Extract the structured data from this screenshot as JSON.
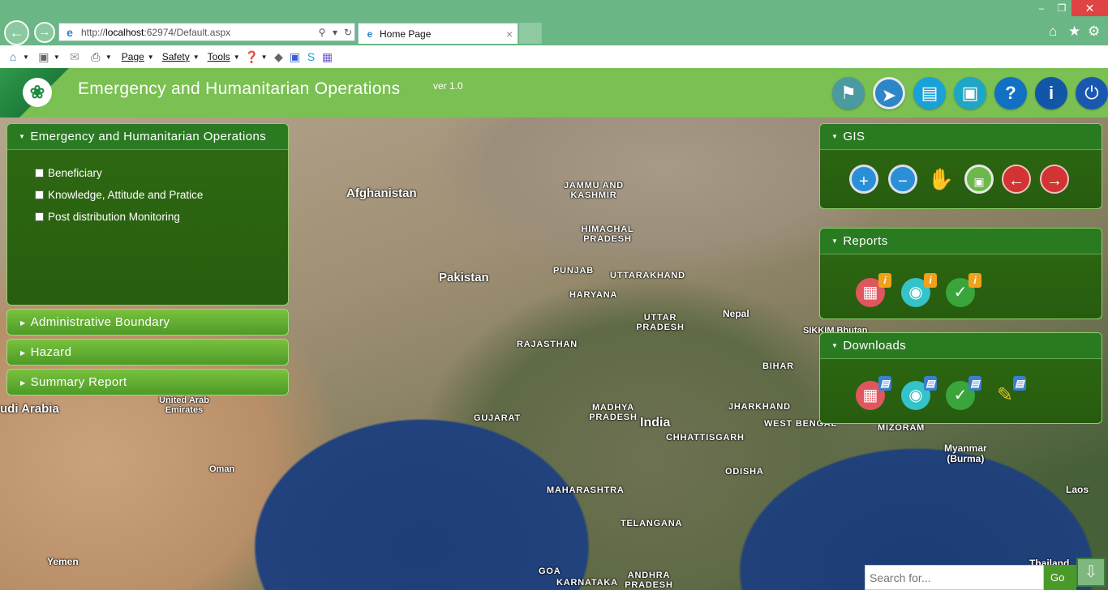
{
  "browser": {
    "address_prefix": "http://",
    "address_host": "localhost",
    "address_rest": ":62974/Default.aspx",
    "tab_title": "Home Page",
    "menu": {
      "page": "Page",
      "safety": "Safety",
      "tools": "Tools"
    }
  },
  "app": {
    "title": "Emergency and Humanitarian Operations",
    "version": "ver 1.0",
    "header_icons": [
      "map-icon",
      "compass-icon",
      "document-icon",
      "monitor-download-icon",
      "help-icon",
      "info-icon",
      "power-icon"
    ]
  },
  "left_panel": {
    "main": {
      "title": "Emergency and Humanitarian Operations",
      "items": [
        "Beneficiary",
        "Knowledge, Attitude and Pratice",
        "Post distribution Monitoring"
      ]
    },
    "accordions": [
      "Administrative Boundary",
      "Hazard",
      "Summary Report"
    ]
  },
  "right_panels": {
    "gis": {
      "title": "GIS",
      "tools": [
        "zoom-in-icon",
        "zoom-out-icon",
        "pan-hand-icon",
        "full-extent-icon",
        "back-arrow-icon",
        "forward-arrow-icon"
      ]
    },
    "reports": {
      "title": "Reports"
    },
    "downloads": {
      "title": "Downloads"
    }
  },
  "map": {
    "labels": [
      "Afghanistan",
      "JAMMU AND KASHMIR",
      "HIMACHAL PRADESH",
      "PUNJAB",
      "UTTARAKHAND",
      "HARYANA",
      "Pakistan",
      "UTTAR PRADESH",
      "Nepal",
      "RAJASTHAN",
      "SIKKIM Bhutan",
      "BIHAR",
      "udi Arabia",
      "United Arab Emirates",
      "GUJARAT",
      "MADHYA PRADESH",
      "JHARKHAND",
      "India",
      "WEST BENGAL",
      "MIZORAM",
      "CHHATTISGARH",
      "Myanmar (Burma)",
      "Oman",
      "ODISHA",
      "MAHARASHTRA",
      "Laos",
      "TELANGANA",
      "Yemen",
      "GOA",
      "KARNATAKA",
      "ANDHRA PRADESH",
      "Thailand"
    ]
  },
  "search": {
    "placeholder": "Search for...",
    "go": "Go"
  }
}
